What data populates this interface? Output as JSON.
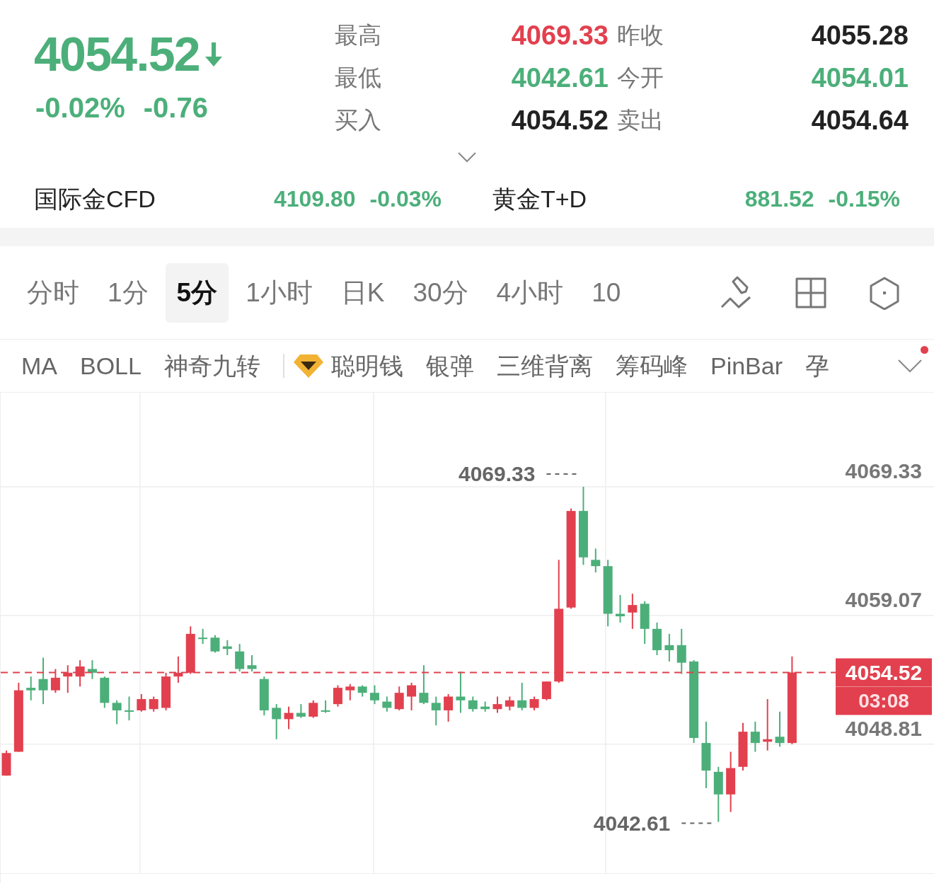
{
  "quote": {
    "price": "4054.52",
    "down": true,
    "color": "#4caf7a",
    "change_percent": "-0.02%",
    "change": "-0.76"
  },
  "stats": [
    {
      "label": "最高",
      "value": "4069.33",
      "color": "#e2404e"
    },
    {
      "label": "昨收",
      "value": "4055.28",
      "color": "#222222"
    },
    {
      "label": "最低",
      "value": "4042.61",
      "color": "#4caf7a"
    },
    {
      "label": "今开",
      "value": "4054.01",
      "color": "#4caf7a"
    },
    {
      "label": "买入",
      "value": "4054.52",
      "color": "#222222"
    },
    {
      "label": "卖出",
      "value": "4054.64",
      "color": "#222222"
    }
  ],
  "related": [
    {
      "name": "国际金CFD",
      "price": "4109.80",
      "change": "-0.03%",
      "color": "#4caf7a"
    },
    {
      "name": "黄金T+D",
      "price": "881.52",
      "change": "-0.15%",
      "color": "#4caf7a"
    }
  ],
  "period_tabs": [
    {
      "label": "分时",
      "selected": false
    },
    {
      "label": "1分",
      "selected": false
    },
    {
      "label": "5分",
      "selected": true
    },
    {
      "label": "1小时",
      "selected": false
    },
    {
      "label": "日K",
      "selected": false
    },
    {
      "label": "30分",
      "selected": false
    },
    {
      "label": "4小时",
      "selected": false
    },
    {
      "label": "10",
      "selected": false
    }
  ],
  "indicators": [
    {
      "label": "MA",
      "kind": "plain"
    },
    {
      "label": "BOLL",
      "kind": "plain"
    },
    {
      "label": "神奇九转",
      "kind": "plain"
    },
    {
      "label": "聪明钱",
      "kind": "premium"
    },
    {
      "label": "银弹",
      "kind": "plain"
    },
    {
      "label": "三维背离",
      "kind": "plain"
    },
    {
      "label": "筹码峰",
      "kind": "plain"
    },
    {
      "label": "PinBar",
      "kind": "plain"
    },
    {
      "label": "孕",
      "kind": "plain"
    }
  ],
  "indicator_menu": {
    "has_notification": true
  },
  "chart": {
    "chart_data": {
      "type": "candlestick",
      "grid": true,
      "ylim": [
        4038.47,
        4076.83
      ],
      "yticks": [
        4048.81,
        4059.07,
        4069.33
      ],
      "ohlc": [
        [
          4046.3,
          4048.3,
          4046.3,
          4048.1
        ],
        [
          4048.2,
          4053.7,
          4048.2,
          4053.1
        ],
        [
          4053.3,
          4054.2,
          4052.3,
          4053.1
        ],
        [
          4054.0,
          4055.7,
          4052.0,
          4053.1
        ],
        [
          4053.1,
          4054.8,
          4052.9,
          4054.1
        ],
        [
          4054.2,
          4055.1,
          4052.9,
          4054.5
        ],
        [
          4054.2,
          4055.5,
          4053.4,
          4055.0
        ],
        [
          4054.8,
          4055.5,
          4054.0,
          4054.5
        ],
        [
          4054.1,
          4054.2,
          4051.7,
          4052.1
        ],
        [
          4052.1,
          4052.3,
          4050.4,
          4051.5
        ],
        [
          4051.5,
          4052.6,
          4050.7,
          4051.4
        ],
        [
          4051.5,
          4052.8,
          4051.4,
          4052.4
        ],
        [
          4051.6,
          4052.6,
          4051.4,
          4052.4
        ],
        [
          4051.7,
          4054.5,
          4051.5,
          4054.2
        ],
        [
          4054.2,
          4055.8,
          4053.7,
          4054.5
        ],
        [
          4054.5,
          4058.2,
          4054.4,
          4057.6
        ],
        [
          4057.3,
          4058.0,
          4056.8,
          4057.2
        ],
        [
          4057.3,
          4057.5,
          4056.1,
          4056.2
        ],
        [
          4056.6,
          4057.1,
          4055.9,
          4056.4
        ],
        [
          4056.2,
          4056.8,
          4054.6,
          4054.8
        ],
        [
          4055.1,
          4055.9,
          4054.6,
          4054.8
        ],
        [
          4054.0,
          4054.2,
          4051.1,
          4051.5
        ],
        [
          4051.7,
          4052.0,
          4049.2,
          4050.8
        ],
        [
          4050.8,
          4051.8,
          4050.0,
          4051.3
        ],
        [
          4051.3,
          4052.0,
          4050.9,
          4051.0
        ],
        [
          4051.0,
          4052.3,
          4050.9,
          4052.1
        ],
        [
          4051.5,
          4052.3,
          4051.3,
          4051.4
        ],
        [
          4052.0,
          4053.5,
          4051.8,
          4053.3
        ],
        [
          4053.1,
          4053.6,
          4052.3,
          4053.4
        ],
        [
          4053.4,
          4053.5,
          4052.6,
          4052.9
        ],
        [
          4052.9,
          4053.5,
          4052.0,
          4052.3
        ],
        [
          4052.2,
          4052.6,
          4051.4,
          4051.7
        ],
        [
          4051.6,
          4053.4,
          4051.5,
          4052.9
        ],
        [
          4052.6,
          4053.7,
          4051.5,
          4053.5
        ],
        [
          4052.9,
          4055.1,
          4052.0,
          4052.1
        ],
        [
          4052.1,
          4052.6,
          4050.3,
          4051.5
        ],
        [
          4051.5,
          4052.8,
          4050.6,
          4052.6
        ],
        [
          4052.6,
          4054.6,
          4051.3,
          4052.3
        ],
        [
          4052.3,
          4052.6,
          4051.4,
          4051.6
        ],
        [
          4051.8,
          4052.2,
          4051.4,
          4051.6
        ],
        [
          4051.6,
          4052.6,
          4051.3,
          4052.0
        ],
        [
          4051.8,
          4052.6,
          4051.5,
          4052.3
        ],
        [
          4052.3,
          4053.7,
          4051.5,
          4051.7
        ],
        [
          4051.7,
          4052.6,
          4051.5,
          4052.4
        ],
        [
          4052.4,
          4053.8,
          4052.3,
          4053.8
        ],
        [
          4053.8,
          4063.5,
          4053.7,
          4059.6
        ],
        [
          4059.7,
          4067.6,
          4059.6,
          4067.4
        ],
        [
          4067.4,
          4069.33,
          4063.1,
          4063.7
        ],
        [
          4063.5,
          4064.4,
          4062.5,
          4063.0
        ],
        [
          4063.0,
          4063.5,
          4058.2,
          4059.2
        ],
        [
          4059.2,
          4060.7,
          4058.5,
          4059.0
        ],
        [
          4059.3,
          4060.8,
          4058.0,
          4059.9
        ],
        [
          4060.0,
          4060.2,
          4056.8,
          4058.0
        ],
        [
          4058.0,
          4058.5,
          4055.9,
          4056.3
        ],
        [
          4056.7,
          4057.6,
          4055.4,
          4056.3
        ],
        [
          4056.7,
          4058.0,
          4054.4,
          4055.3
        ],
        [
          4055.4,
          4055.5,
          4048.9,
          4049.3
        ],
        [
          4048.9,
          4050.6,
          4045.3,
          4046.7
        ],
        [
          4046.6,
          4047.0,
          4042.61,
          4044.8
        ],
        [
          4044.8,
          4048.2,
          4043.4,
          4046.9
        ],
        [
          4047.0,
          4050.5,
          4046.7,
          4049.8
        ],
        [
          4049.8,
          4050.6,
          4048.2,
          4048.9
        ],
        [
          4049.0,
          4052.4,
          4048.3,
          4049.2
        ],
        [
          4049.4,
          4051.4,
          4048.6,
          4048.9
        ],
        [
          4048.9,
          4055.8,
          4048.8,
          4054.52
        ]
      ],
      "annotations": [
        "4069.33",
        "4042.61"
      ],
      "ref_lines": [
        {
          "axis": "y",
          "value": 4054.52,
          "label": "4054.52"
        }
      ]
    },
    "countdown": "03:08"
  }
}
